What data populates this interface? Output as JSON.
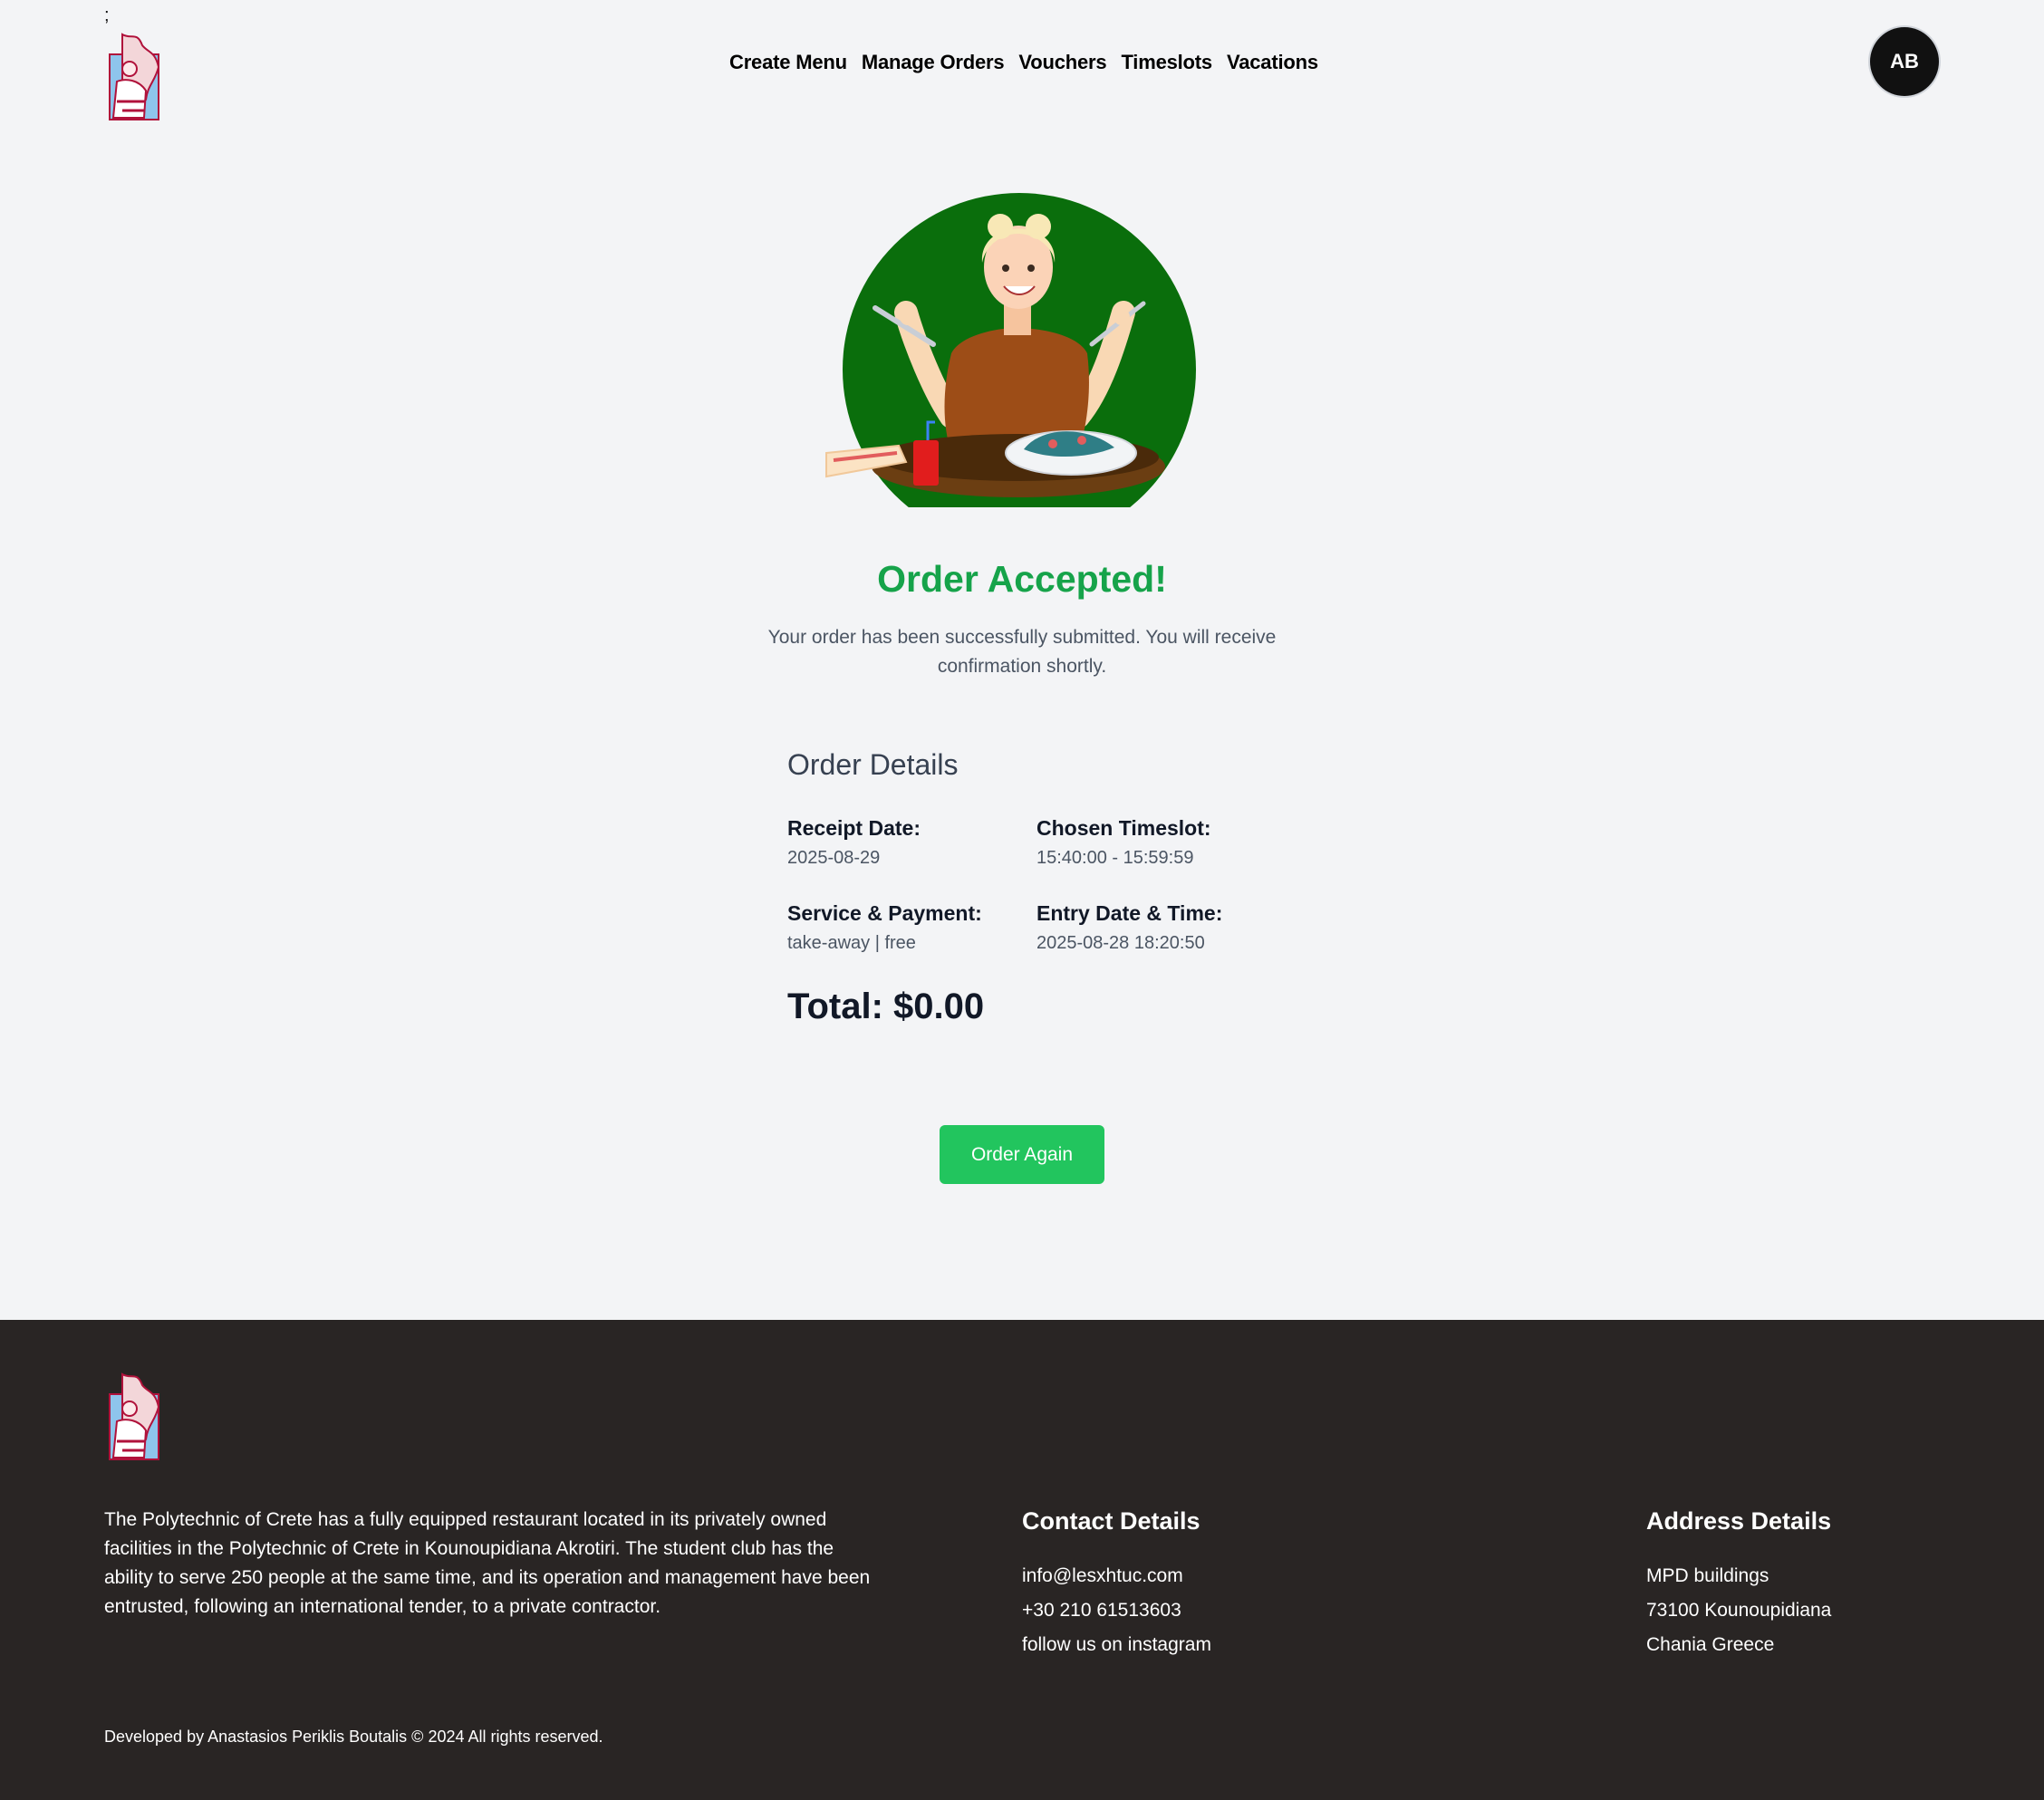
{
  "stray_char": ";",
  "nav": {
    "items": [
      {
        "label": "Create Menu"
      },
      {
        "label": "Manage Orders"
      },
      {
        "label": "Vouchers"
      },
      {
        "label": "Timeslots"
      },
      {
        "label": "Vacations"
      }
    ]
  },
  "user": {
    "initials": "AB"
  },
  "main": {
    "title": "Order Accepted!",
    "subtitle": "Your order has been successfully submitted. You will receive confirmation shortly.",
    "details_heading": "Order Details",
    "fields": {
      "receipt_date_label": "Receipt Date:",
      "receipt_date_value": "2025-08-29",
      "timeslot_label": "Chosen Timeslot:",
      "timeslot_value": "15:40:00 - 15:59:59",
      "service_label": "Service & Payment:",
      "service_value": "take-away | free",
      "entry_label": "Entry Date & Time:",
      "entry_value": "2025-08-28 18:20:50"
    },
    "total": "Total: $0.00",
    "order_again_label": "Order Again"
  },
  "footer": {
    "about": "The Polytechnic of Crete has a fully equipped restaurant located in its privately owned facilities in the Polytechnic of Crete in Kounoupidiana Akrotiri. The student club has the ability to serve 250 people at the same time, and its operation and management have been entrusted, following an international tender, to a private contractor.",
    "contact": {
      "heading": "Contact Details",
      "email": "info@lesxhtuc.com",
      "phone": "+30 210 61513603",
      "instagram": "follow us on instagram"
    },
    "address": {
      "heading": "Address Details",
      "line1": "MPD buildings",
      "line2": "73100 Kounoupidiana",
      "line3": "Chania Greece"
    },
    "copyright": "Developed by Anastasios Periklis Boutalis © 2024 All rights reserved."
  },
  "colors": {
    "accent": "#22c55e",
    "title_green": "#16a34a",
    "hero_circle": "#0a6e0c",
    "footer_bg": "#292524"
  }
}
